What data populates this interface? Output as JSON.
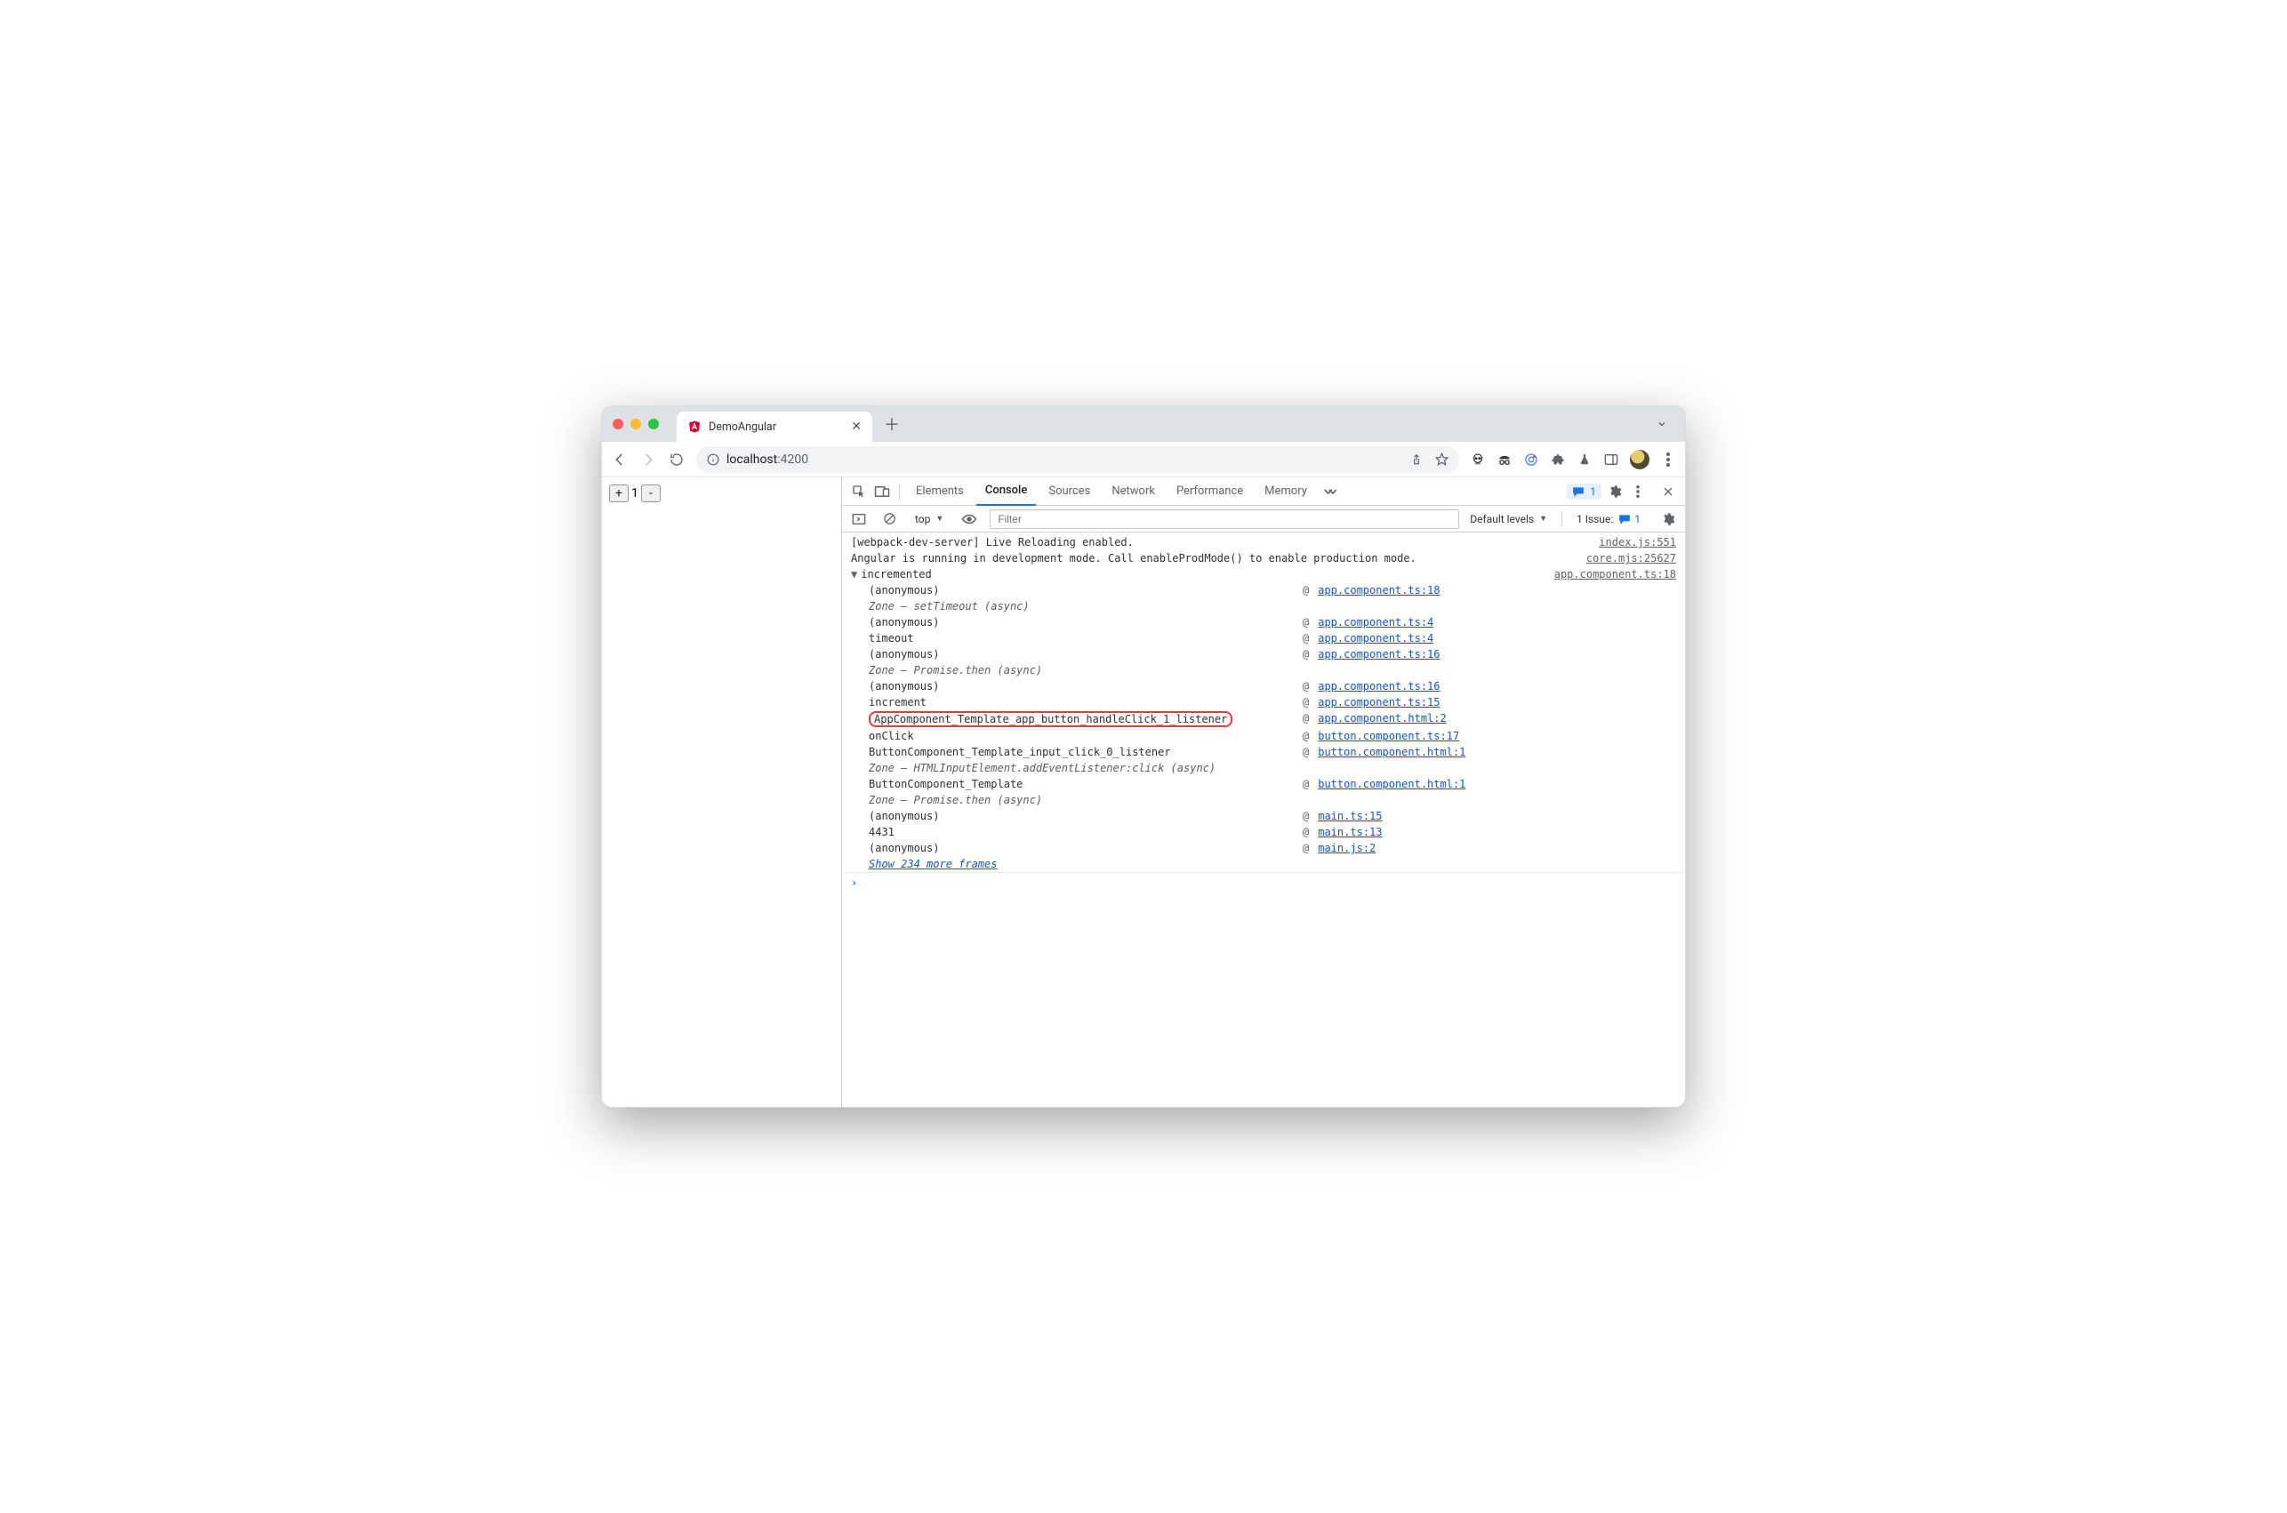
{
  "window": {
    "tab_title": "DemoAngular"
  },
  "url": {
    "host": "localhost",
    "port": ":4200"
  },
  "page": {
    "counter_value": "1"
  },
  "devtools": {
    "tabs": {
      "elements": "Elements",
      "console": "Console",
      "sources": "Sources",
      "network": "Network",
      "performance": "Performance",
      "memory": "Memory"
    },
    "issues_pill": "1",
    "toolbar": {
      "context": "top",
      "filter_placeholder": "Filter",
      "levels": "Default levels",
      "issue_label": "1 Issue:",
      "issue_count": "1"
    }
  },
  "console": {
    "rows": [
      {
        "msg": "[webpack-dev-server] Live Reloading enabled.",
        "src": "index.js:551"
      },
      {
        "msg": "Angular is running in development mode. Call enableProdMode() to enable production mode.",
        "src": "core.mjs:25627"
      }
    ],
    "trace_label": "incremented",
    "trace_src": "app.component.ts:18",
    "trace": [
      {
        "fn": "(anonymous)",
        "loc": "app.component.ts:18"
      },
      {
        "fn": "Zone — setTimeout (async)",
        "zone": true
      },
      {
        "fn": "(anonymous)",
        "loc": "app.component.ts:4"
      },
      {
        "fn": "timeout",
        "loc": "app.component.ts:4"
      },
      {
        "fn": "(anonymous)",
        "loc": "app.component.ts:16"
      },
      {
        "fn": "Zone — Promise.then (async)",
        "zone": true
      },
      {
        "fn": "(anonymous)",
        "loc": "app.component.ts:16"
      },
      {
        "fn": "increment",
        "loc": "app.component.ts:15"
      },
      {
        "fn": "AppComponent_Template_app_button_handleClick_1_listener",
        "loc": "app.component.html:2",
        "highlight": true
      },
      {
        "fn": "onClick",
        "loc": "button.component.ts:17"
      },
      {
        "fn": "ButtonComponent_Template_input_click_0_listener",
        "loc": "button.component.html:1"
      },
      {
        "fn": "Zone — HTMLInputElement.addEventListener:click (async)",
        "zone": true
      },
      {
        "fn": "ButtonComponent_Template",
        "loc": "button.component.html:1"
      },
      {
        "fn": "Zone — Promise.then (async)",
        "zone": true
      },
      {
        "fn": "(anonymous)",
        "loc": "main.ts:15"
      },
      {
        "fn": "4431",
        "loc": "main.ts:13"
      },
      {
        "fn": "(anonymous)",
        "loc": "main.js:2"
      }
    ],
    "show_more": "Show 234 more frames"
  }
}
